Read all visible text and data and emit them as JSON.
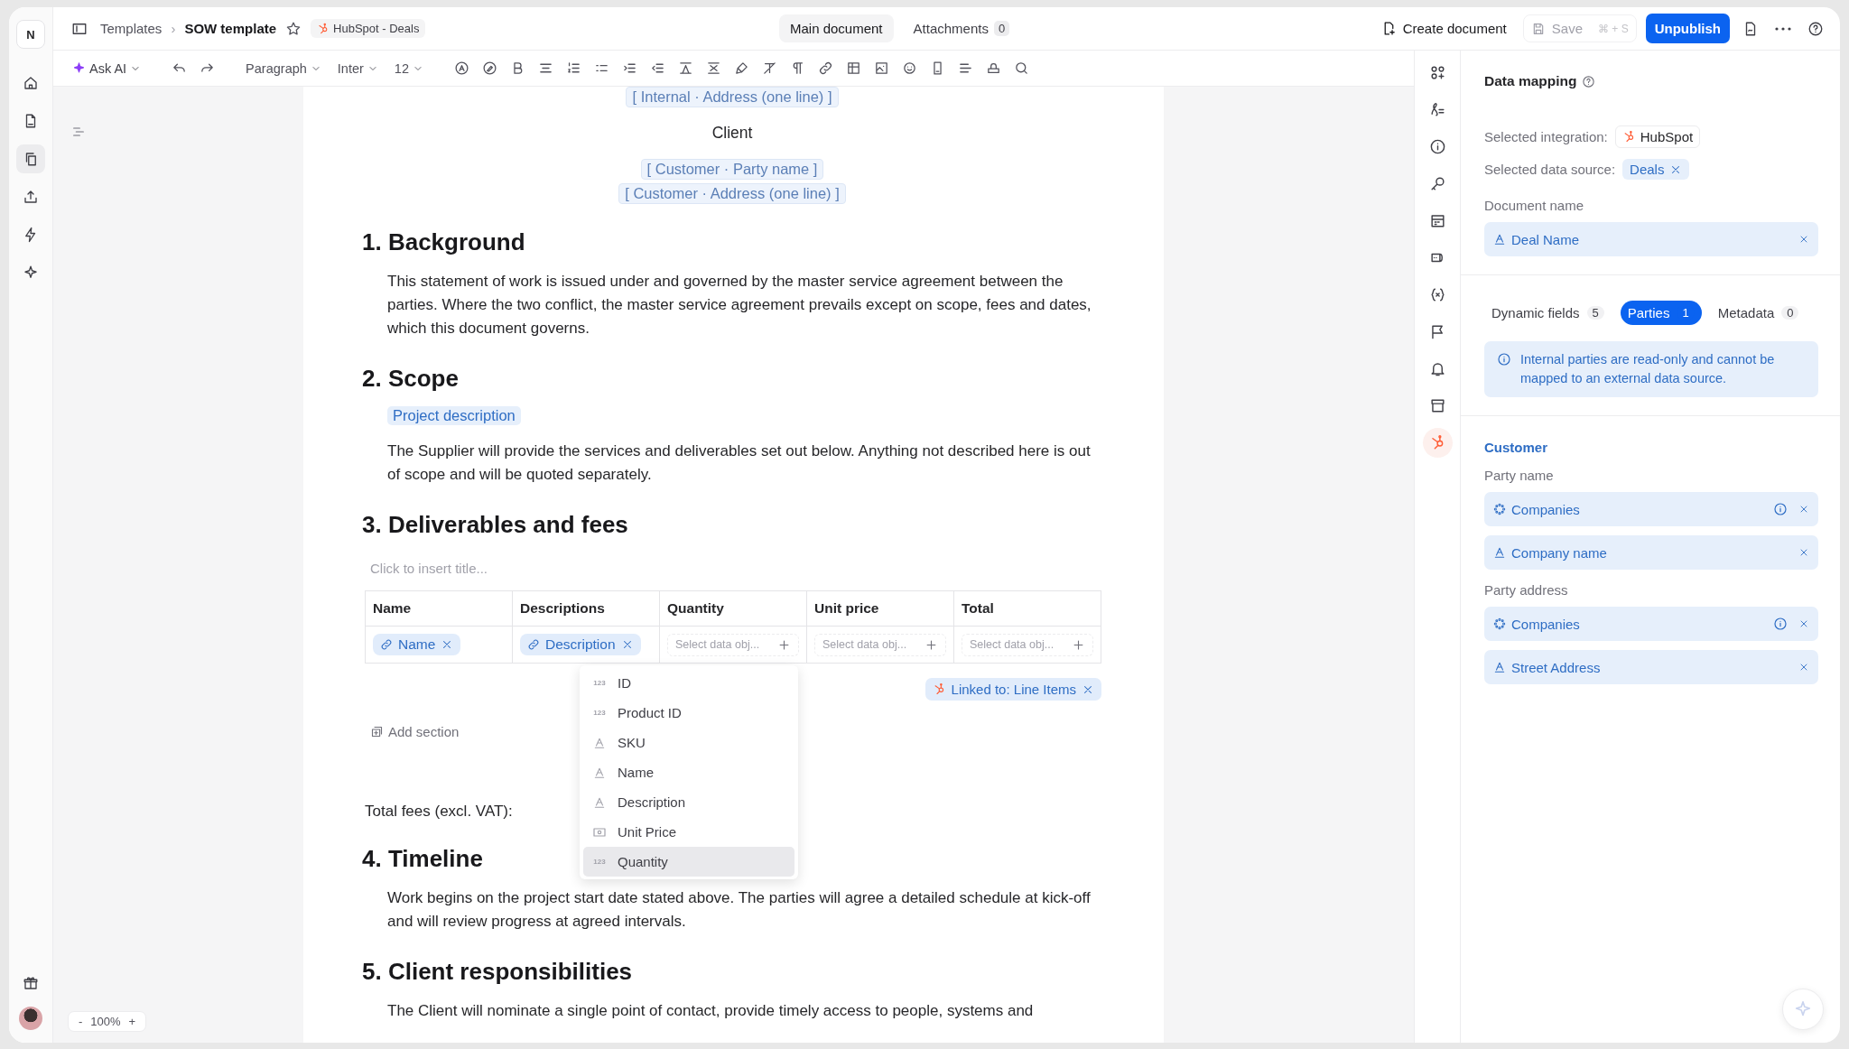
{
  "top_bar": {
    "logo": "N",
    "breadcrumb": [
      "Templates",
      "SOW template"
    ],
    "separator": "›",
    "starred": false,
    "integration_chip": "HubSpot - Deals",
    "tabs": [
      {
        "label": "Main document",
        "selected": true
      },
      {
        "label": "Attachments",
        "count": "0",
        "selected": false
      }
    ],
    "create_document": "Create document",
    "save": {
      "label": "Save",
      "shortcut": "⌘ + S",
      "disabled": true
    },
    "publish_button": "Unpublish"
  },
  "left_rail": {
    "items": [
      {
        "selected": false
      },
      {
        "selected": false
      },
      {
        "selected": true
      },
      {
        "selected": false
      },
      {
        "selected": false
      },
      {
        "selected": false
      }
    ]
  },
  "toolbar": {
    "ask_ai": "Ask AI",
    "block_style": "Paragraph",
    "font": "Inter",
    "font_size": "12"
  },
  "zoom": {
    "minus": "-",
    "value": "100%",
    "plus": "+"
  },
  "document": {
    "internal_address": "[ Internal · Address (one line) ]",
    "client_label": "Client",
    "customer_fields": [
      "[ Customer · Party name ]",
      "[ Customer · Address (one line) ]"
    ],
    "sections": [
      {
        "heading": "1. Background",
        "blocks": [
          {
            "kind": "paragraph",
            "text": "This statement of work is issued under and governed by the master service agreement between the parties. Where the two conflict, the master service agreement prevails except on scope, fees and dates, which this document governs."
          }
        ]
      },
      {
        "heading": "2. Scope",
        "blocks": [
          {
            "kind": "field",
            "text": "Project description"
          },
          {
            "kind": "paragraph",
            "text": "The Supplier will provide the services and deliverables set out below. Anything not described here is out of scope and will be quoted separately."
          }
        ]
      },
      {
        "heading": "3. Deliverables and fees",
        "blocks": [
          {
            "kind": "table",
            "title_placeholder": "Click to insert title...",
            "columns": [
              "Name",
              "Descriptions",
              "Quantity",
              "Unit price",
              "Total"
            ],
            "cells": [
              {
                "kind": "mapped",
                "text": "Name"
              },
              {
                "kind": "mapped",
                "text": "Description"
              },
              {
                "kind": "empty",
                "placeholder": "Select data obj..."
              },
              {
                "kind": "empty",
                "placeholder": "Select data obj..."
              },
              {
                "kind": "empty",
                "placeholder": "Select data obj..."
              }
            ],
            "linked": "Linked to: Line Items",
            "add_section": "Add section",
            "total_label": "Total fees (excl. VAT):",
            "dropdown": [
              {
                "kind": "number",
                "badge": "123",
                "label": "ID",
                "selected": false
              },
              {
                "kind": "number",
                "badge": "123",
                "label": "Product ID",
                "selected": false
              },
              {
                "kind": "text",
                "label": "SKU",
                "selected": false
              },
              {
                "kind": "text",
                "label": "Name",
                "selected": false
              },
              {
                "kind": "text",
                "label": "Description",
                "selected": false
              },
              {
                "kind": "currency",
                "label": "Unit Price",
                "selected": false
              },
              {
                "kind": "number",
                "badge": "123",
                "label": "Quantity",
                "selected": true
              }
            ]
          }
        ]
      },
      {
        "heading": "4. Timeline",
        "blocks": [
          {
            "kind": "paragraph",
            "text": "Work begins on the project start date stated above. The parties will agree a detailed schedule at kick-off and will review progress at agreed intervals."
          }
        ]
      },
      {
        "heading": "5. Client responsibilities",
        "blocks": [
          {
            "kind": "paragraph",
            "text": "The Client will nominate a single point of contact, provide timely access to people, systems and"
          }
        ]
      }
    ]
  },
  "right_rail": {
    "items": [
      {
        "selected": false
      },
      {
        "selected": false
      },
      {
        "selected": false
      },
      {
        "selected": false
      },
      {
        "selected": false
      },
      {
        "selected": false
      },
      {
        "selected": false
      },
      {
        "selected": false
      },
      {
        "selected": false
      },
      {
        "selected": false
      },
      {
        "selected": true
      }
    ]
  },
  "data_mapping": {
    "title": "Data mapping",
    "integration_label": "Selected integration:",
    "integration": "HubSpot",
    "data_source_label": "Selected data source:",
    "data_source": "Deals",
    "document_name_label": "Document name",
    "document_name": {
      "kind": "text",
      "label": "Deal Name"
    },
    "tabs": [
      {
        "label": "Dynamic fields",
        "count": "5",
        "selected": false
      },
      {
        "label": "Parties",
        "count": "1",
        "selected": true
      },
      {
        "label": "Metadata",
        "count": "0",
        "selected": false
      }
    ],
    "notice": "Internal parties are read-only and cannot be mapped to an external data source.",
    "party": {
      "name": "Customer",
      "groups": [
        {
          "label": "Party name",
          "fields": [
            {
              "kind": "object",
              "label": "Companies"
            },
            {
              "kind": "text",
              "label": "Company name"
            }
          ]
        },
        {
          "label": "Party address",
          "fields": [
            {
              "kind": "object",
              "label": "Companies"
            },
            {
              "kind": "text",
              "label": "Street Address"
            }
          ]
        }
      ]
    }
  }
}
